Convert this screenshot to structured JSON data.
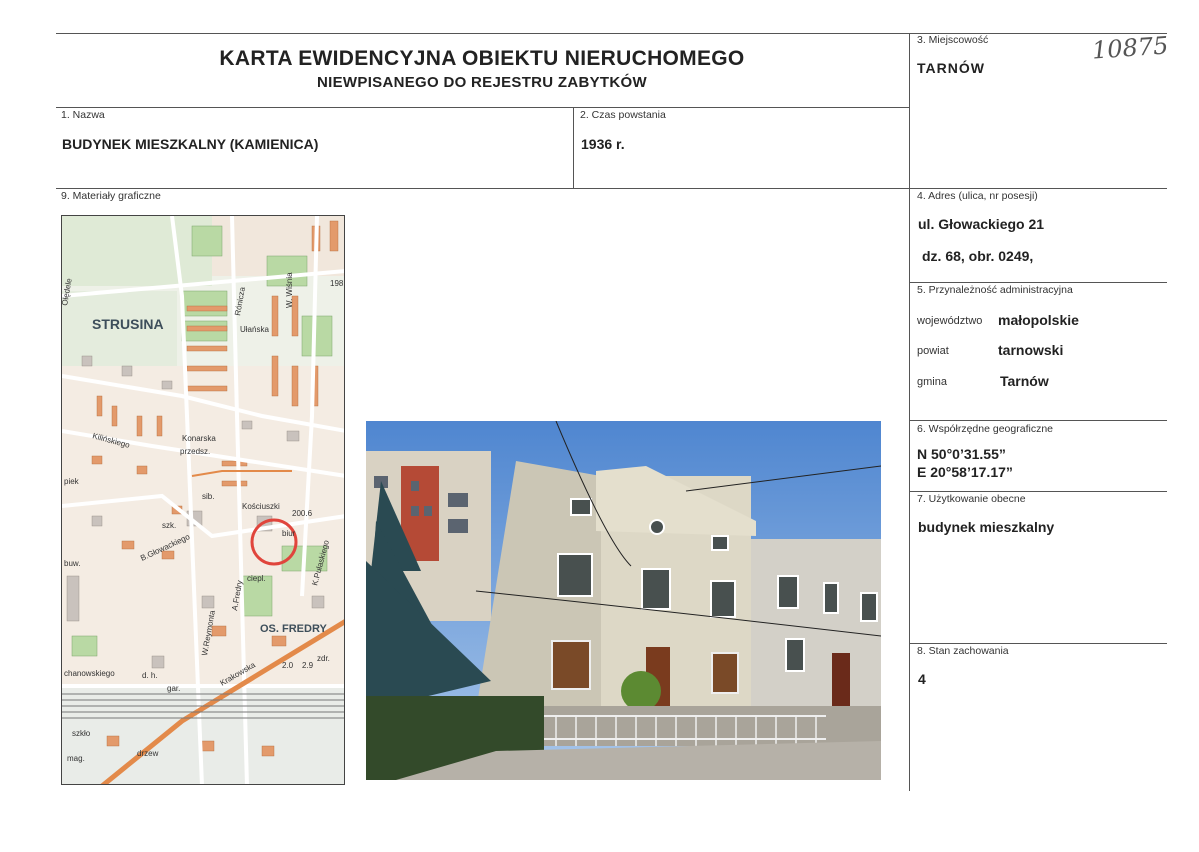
{
  "document": {
    "title": "KARTA EWIDENCYJNA OBIEKTU NIERUCHOMEGO",
    "subtitle": "NIEWPISANEGO DO REJESTRU ZABYTKÓW",
    "handwritten_number": "10875"
  },
  "fields": {
    "locality": {
      "label": "3. Miejscowość",
      "value": "TARNÓW"
    },
    "name": {
      "label": "1. Nazwa",
      "value": "BUDYNEK MIESZKALNY (KAMIENICA)"
    },
    "date": {
      "label": "2. Czas powstania",
      "value": "1936 r."
    },
    "graphics": {
      "label": "9. Materiały graficzne"
    },
    "address": {
      "label": "4. Adres (ulica, nr posesji)",
      "line1": "ul. Głowackiego 21",
      "line2": "dz. 68, obr. 0249,"
    },
    "admin": {
      "label": "5. Przynależność administracyjna",
      "voivodeship_label": "województwo",
      "voivodeship": "małopolskie",
      "county_label": "powiat",
      "county": "tarnowski",
      "commune_label": "gmina",
      "commune": "Tarnów"
    },
    "coords": {
      "label": "6. Współrzędne geograficzne",
      "n": "N 50°0’31.55”",
      "e": "E 20°58’17.17”"
    },
    "usage": {
      "label": "7. Użytkowanie obecne",
      "value": "budynek mieszkalny"
    },
    "condition": {
      "label": "8. Stan zachowania",
      "value": "4"
    }
  },
  "map": {
    "labels": {
      "strusina": "STRUSINA",
      "os_fredry": "OS. FREDRY",
      "oledele": "Ołędele",
      "ulanska": "Ułańska",
      "wisnia": "W. Wiśnia",
      "ronicza": "Rónicza",
      "konarska": "Konarska",
      "przedsz": "przedsz.",
      "kilinskiego": "Kilińskiego",
      "kosciuszki": "Kościuszki",
      "glowackiego": "B.Głowackiego",
      "szk": "szk.",
      "biur": "biur",
      "ciepl": "ciepl.",
      "krakowska": "Krakowska",
      "pulaskiego": "K.Pułaskiego",
      "fredry": "A.Fredry",
      "reymonta": "W.Reymonta",
      "piek": "piek",
      "buw": "buw.",
      "chanowskiego": "chanowskiego",
      "dh": "d. h.",
      "gar": "gar.",
      "elev1": "200.6",
      "elev2": "198",
      "elev3": "2.0",
      "elev4": "2.9",
      "mag": "mag.",
      "szklo": "szkło",
      "drzew": "drzew",
      "zdr": "zdr.",
      "sib": "sib."
    }
  },
  "colors": {
    "map_background": "#e9efe3",
    "map_highlight_circle": "#e0453c",
    "road_orange": "#e38a4a",
    "sky": "#5a8fd4"
  }
}
